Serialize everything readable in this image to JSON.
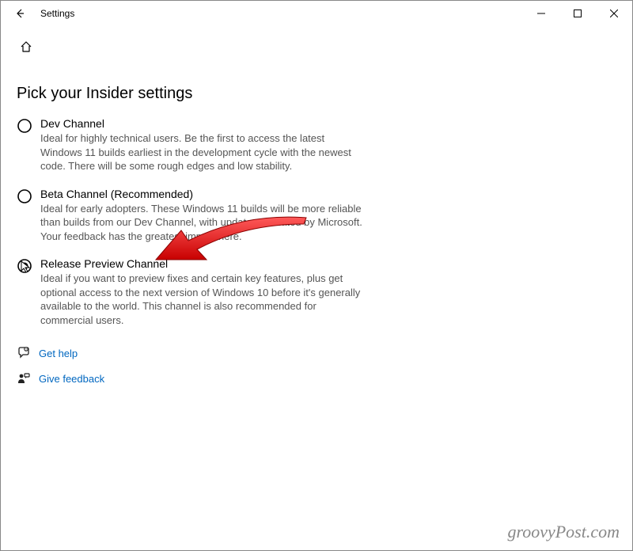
{
  "titlebar": {
    "title": "Settings"
  },
  "page": {
    "heading": "Pick your Insider settings"
  },
  "options": [
    {
      "title": "Dev Channel",
      "desc": "Ideal for highly technical users. Be the first to access the latest Windows 11 builds earliest in the development cycle with the newest code. There will be some rough edges and low stability."
    },
    {
      "title": "Beta Channel (Recommended)",
      "desc": "Ideal for early adopters. These Windows 11 builds will be more reliable than builds from our Dev Channel, with updates validated by Microsoft. Your feedback has the greatest impact here."
    },
    {
      "title": "Release Preview Channel",
      "desc": "Ideal if you want to preview fixes and certain key features, plus get optional access to the next version of Windows 10 before it's generally available to the world. This channel is also recommended for commercial users."
    }
  ],
  "links": {
    "help": "Get help",
    "feedback": "Give feedback"
  },
  "watermark": "groovyPost.com"
}
